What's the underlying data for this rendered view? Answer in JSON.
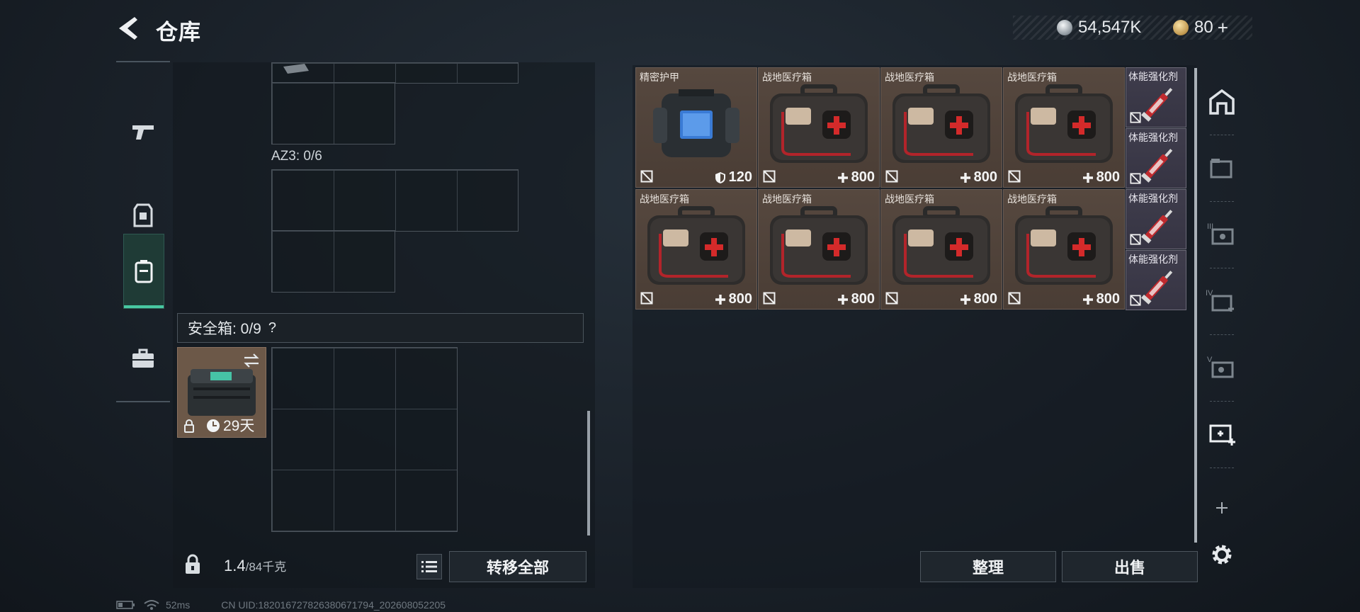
{
  "header": {
    "title": "仓库",
    "silver": "54,547K",
    "gold": "80"
  },
  "left_panel": {
    "az3_label": "AZ3: 0/6",
    "safe_label": "安全箱: 0/9",
    "safe_help": "?",
    "safebox_time": "29天",
    "weight_value": "1.4",
    "weight_capacity": "/84千克",
    "transfer_all": "转移全部"
  },
  "items": [
    {
      "name": "精密护甲",
      "stat": "120",
      "stat_icon": "shield-icon"
    },
    {
      "name": "战地医疗箱",
      "stat": "800",
      "stat_icon": "plus-icon"
    },
    {
      "name": "战地医疗箱",
      "stat": "800",
      "stat_icon": "plus-icon"
    },
    {
      "name": "战地医疗箱",
      "stat": "800",
      "stat_icon": "plus-icon"
    },
    {
      "name": "战地医疗箱",
      "stat": "800",
      "stat_icon": "plus-icon"
    },
    {
      "name": "战地医疗箱",
      "stat": "800",
      "stat_icon": "plus-icon"
    },
    {
      "name": "战地医疗箱",
      "stat": "800",
      "stat_icon": "plus-icon"
    },
    {
      "name": "战地医疗箱",
      "stat": "800",
      "stat_icon": "plus-icon"
    }
  ],
  "slim_items": [
    {
      "name": "体能强化剂"
    },
    {
      "name": "体能强化剂"
    },
    {
      "name": "体能强化剂"
    },
    {
      "name": "体能强化剂"
    }
  ],
  "right_panel": {
    "sort": "整理",
    "sell": "出售"
  },
  "right_rail": {
    "roman_3": "III",
    "roman_4": "IV",
    "roman_5": "V"
  },
  "status": {
    "ping": "52ms",
    "uid": "CN UID:1820167278263806717​94_202608052205"
  },
  "colors": {
    "accent": "#48c8a2",
    "item_bg": "#4e4138",
    "slim_bg": "#3b3948"
  }
}
